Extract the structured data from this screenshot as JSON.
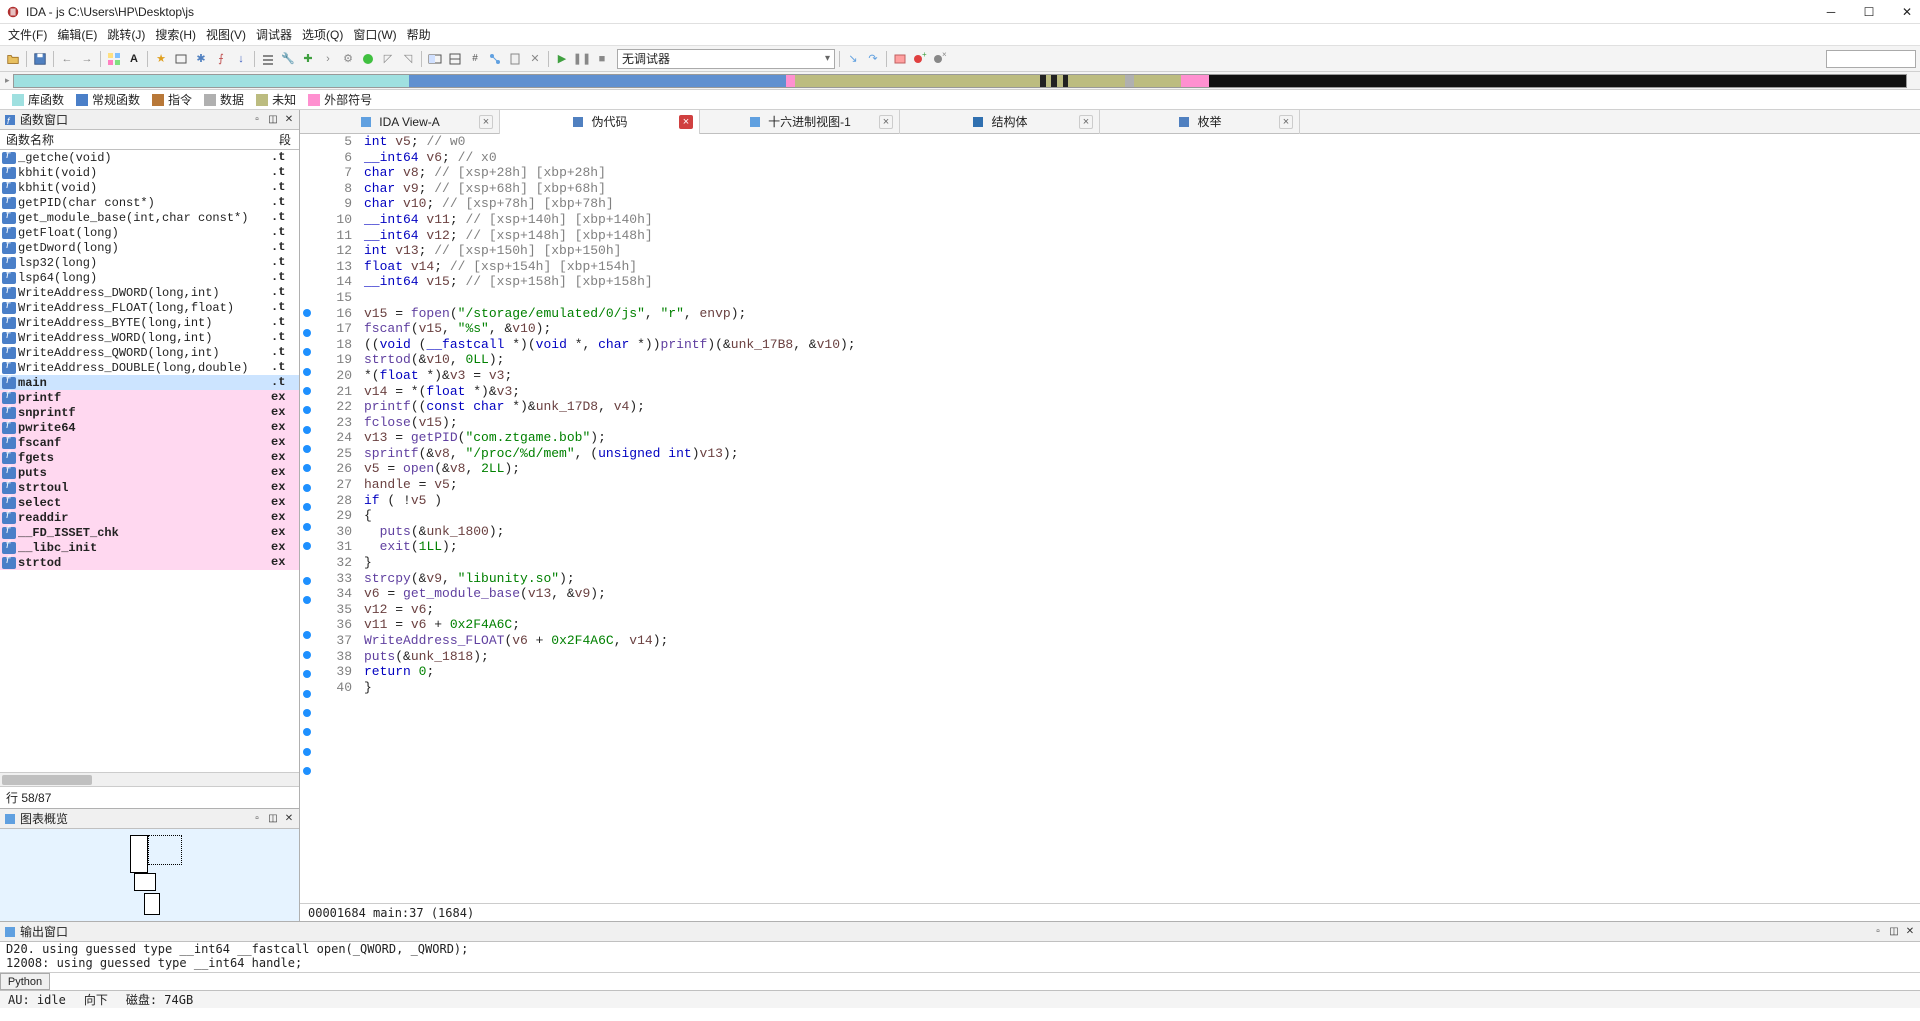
{
  "window": {
    "title": "IDA - js C:\\Users\\HP\\Desktop\\js"
  },
  "menus": [
    "文件(F)",
    "编辑(E)",
    "跳转(J)",
    "搜索(H)",
    "视图(V)",
    "调试器",
    "选项(Q)",
    "窗口(W)",
    "帮助"
  ],
  "debugger_combo": "无调试器",
  "legend": [
    {
      "color": "#9fe0e0",
      "label": "库函数"
    },
    {
      "color": "#4a7fc8",
      "label": "常规函数"
    },
    {
      "color": "#b87838",
      "label": "指令"
    },
    {
      "color": "#b0b0b0",
      "label": "数据"
    },
    {
      "color": "#bcbc80",
      "label": "未知"
    },
    {
      "color": "#ff90d0",
      "label": "外部符号"
    }
  ],
  "functions_panel": {
    "title": "函数窗口",
    "col1": "函数名称",
    "col2": "段",
    "row_count": "行 58/87",
    "items": [
      {
        "name": "_getche(void)",
        "seg": ".t"
      },
      {
        "name": "kbhit(void)",
        "seg": ".t"
      },
      {
        "name": "kbhit(void)",
        "seg": ".t"
      },
      {
        "name": "getPID(char const*)",
        "seg": ".t"
      },
      {
        "name": "get_module_base(int,char const*)",
        "seg": ".t"
      },
      {
        "name": "getFloat(long)",
        "seg": ".t"
      },
      {
        "name": "getDword(long)",
        "seg": ".t"
      },
      {
        "name": "lsp32(long)",
        "seg": ".t"
      },
      {
        "name": "lsp64(long)",
        "seg": ".t"
      },
      {
        "name": "WriteAddress_DWORD(long,int)",
        "seg": ".t"
      },
      {
        "name": "WriteAddress_FLOAT(long,float)",
        "seg": ".t"
      },
      {
        "name": "WriteAddress_BYTE(long,int)",
        "seg": ".t"
      },
      {
        "name": "WriteAddress_WORD(long,int)",
        "seg": ".t"
      },
      {
        "name": "WriteAddress_QWORD(long,int)",
        "seg": ".t"
      },
      {
        "name": "WriteAddress_DOUBLE(long,double)",
        "seg": ".t"
      },
      {
        "name": "main",
        "seg": ".t",
        "bold": true,
        "sel": true
      },
      {
        "name": "printf",
        "seg": "ex",
        "ext": true
      },
      {
        "name": "snprintf",
        "seg": "ex",
        "ext": true
      },
      {
        "name": "pwrite64",
        "seg": "ex",
        "ext": true
      },
      {
        "name": "fscanf",
        "seg": "ex",
        "ext": true
      },
      {
        "name": "fgets",
        "seg": "ex",
        "ext": true
      },
      {
        "name": "puts",
        "seg": "ex",
        "ext": true
      },
      {
        "name": "strtoul",
        "seg": "ex",
        "ext": true
      },
      {
        "name": "select",
        "seg": "ex",
        "ext": true
      },
      {
        "name": "readdir",
        "seg": "ex",
        "ext": true
      },
      {
        "name": "__FD_ISSET_chk",
        "seg": "ex",
        "ext": true
      },
      {
        "name": "__libc_init",
        "seg": "ex",
        "ext": true
      },
      {
        "name": "strtod",
        "seg": "ex",
        "ext": true,
        "cut": true
      }
    ]
  },
  "graph_panel": {
    "title": "图表概览"
  },
  "tabs": [
    {
      "label": "IDA View-A",
      "icon": "view",
      "close": true
    },
    {
      "label": "伪代码",
      "icon": "pseudo",
      "close": true,
      "active": true,
      "closeRed": true
    },
    {
      "label": "十六进制视图-1",
      "icon": "hex",
      "close": true
    },
    {
      "label": "结构体",
      "icon": "struct",
      "close": true
    },
    {
      "label": "枚举",
      "icon": "enum",
      "close": true
    }
  ],
  "code": {
    "first_line": 5,
    "breakpoints": [
      16,
      17,
      18,
      19,
      20,
      21,
      22,
      23,
      24,
      25,
      26,
      27,
      28,
      30,
      31,
      33,
      34,
      35,
      36,
      37,
      38,
      39,
      40
    ],
    "lines": [
      {
        "n": 5,
        "html": "<span class='ty'>int</span> <span class='var'>v5</span>; <span class='cmt'>// w0</span>"
      },
      {
        "n": 6,
        "html": "<span class='ty'>__int64</span> <span class='var'>v6</span>; <span class='cmt'>// x0</span>"
      },
      {
        "n": 7,
        "html": "<span class='ty'>char</span> <span class='var'>v8</span>; <span class='cmt'>// [xsp+28h] [xbp+28h]</span>"
      },
      {
        "n": 8,
        "html": "<span class='ty'>char</span> <span class='var'>v9</span>; <span class='cmt'>// [xsp+68h] [xbp+68h]</span>"
      },
      {
        "n": 9,
        "html": "<span class='ty'>char</span> <span class='var'>v10</span>; <span class='cmt'>// [xsp+78h] [xbp+78h]</span>"
      },
      {
        "n": 10,
        "html": "<span class='ty'>__int64</span> <span class='var'>v11</span>; <span class='cmt'>// [xsp+140h] [xbp+140h]</span>"
      },
      {
        "n": 11,
        "html": "<span class='ty'>__int64</span> <span class='var'>v12</span>; <span class='cmt'>// [xsp+148h] [xbp+148h]</span>"
      },
      {
        "n": 12,
        "html": "<span class='ty'>int</span> <span class='var'>v13</span>; <span class='cmt'>// [xsp+150h] [xbp+150h]</span>"
      },
      {
        "n": 13,
        "html": "<span class='ty'>float</span> <span class='var'>v14</span>; <span class='cmt'>// [xsp+154h] [xbp+154h]</span>"
      },
      {
        "n": 14,
        "html": "<span class='ty'>__int64</span> <span class='var'>v15</span>; <span class='cmt'>// [xsp+158h] [xbp+158h]</span>"
      },
      {
        "n": 15,
        "html": ""
      },
      {
        "n": 16,
        "html": "<span class='var'>v15</span> = <span class='fncall'>fopen</span>(<span class='str'>\"/storage/emulated/0/js\"</span>, <span class='str'>\"r\"</span>, <span class='var'>envp</span>);"
      },
      {
        "n": 17,
        "html": "<span class='fncall'>fscanf</span>(<span class='var'>v15</span>, <span class='str'>\"%s\"</span>, &<span class='var'>v10</span>);"
      },
      {
        "n": 18,
        "html": "((<span class='ty'>void</span> (<span class='ty'>__fastcall</span> *)(<span class='ty'>void</span> *, <span class='ty'>char</span> *))<span class='fncall'>printf</span>)(&<span class='var'>unk_17B8</span>, &<span class='var'>v10</span>);"
      },
      {
        "n": 19,
        "html": "<span class='fncall'>strtod</span>(&<span class='var'>v10</span>, <span class='num'>0LL</span>);"
      },
      {
        "n": 20,
        "html": "*(<span class='ty'>float</span> *)&<span class='var'>v3</span> = <span class='var'>v3</span>;"
      },
      {
        "n": 21,
        "html": "<span class='var'>v14</span> = *(<span class='ty'>float</span> *)&<span class='var'>v3</span>;"
      },
      {
        "n": 22,
        "html": "<span class='fncall'>printf</span>((<span class='ty'>const</span> <span class='ty'>char</span> *)&<span class='var'>unk_17D8</span>, <span class='var'>v4</span>);"
      },
      {
        "n": 23,
        "html": "<span class='fncall'>fclose</span>(<span class='var'>v15</span>);"
      },
      {
        "n": 24,
        "html": "<span class='var'>v13</span> = <span class='fncall'>getPID</span>(<span class='str'>\"com.ztgame.bob\"</span>);"
      },
      {
        "n": 25,
        "html": "<span class='fncall'>sprintf</span>(&<span class='var'>v8</span>, <span class='str'>\"/proc/%d/mem\"</span>, (<span class='ty'>unsigned</span> <span class='ty'>int</span>)<span class='var'>v13</span>);"
      },
      {
        "n": 26,
        "html": "<span class='var'>v5</span> = <span class='fncall'>open</span>(&<span class='var'>v8</span>, <span class='num'>2LL</span>);"
      },
      {
        "n": 27,
        "html": "<span class='var'>handle</span> = <span class='var'>v5</span>;"
      },
      {
        "n": 28,
        "html": "<span class='kw'>if</span> ( !<span class='var'>v5</span> )"
      },
      {
        "n": 29,
        "html": "{"
      },
      {
        "n": 30,
        "html": "  <span class='fncall'>puts</span>(&<span class='var'>unk_1800</span>);"
      },
      {
        "n": 31,
        "html": "  <span class='fncall'>exit</span>(<span class='num'>1LL</span>);"
      },
      {
        "n": 32,
        "html": "}"
      },
      {
        "n": 33,
        "html": "<span class='fncall'>strcpy</span>(&<span class='var'>v9</span>, <span class='str'>\"libunity.so\"</span>);"
      },
      {
        "n": 34,
        "html": "<span class='var'>v6</span> = <span class='fncall'>get_module_base</span>(<span class='var'>v13</span>, &<span class='var'>v9</span>);"
      },
      {
        "n": 35,
        "html": "<span class='var'>v12</span> = <span class='var'>v6</span>;"
      },
      {
        "n": 36,
        "html": "<span class='var'>v11</span> = <span class='var'>v6</span> + <span class='num'>0x2F4A6C</span>;"
      },
      {
        "n": 37,
        "html": "<span class='fncall'>WriteAddress_FLOAT</span>(<span class='var'>v6</span> + <span class='num'>0x2F4A6C</span>, <span class='var'>v14</span>);"
      },
      {
        "n": 38,
        "html": "<span class='fncall'>puts</span>(&<span class='var'>unk_1818</span>);"
      },
      {
        "n": 39,
        "html": "<span class='kw'>return</span> <span class='num'>0</span>;"
      },
      {
        "n": 40,
        "html": "}"
      }
    ],
    "status": "00001684 main:37 (1684)"
  },
  "output_panel": {
    "title": "输出窗口",
    "lines": [
      "D20. using guessed type __int64 __fastcall open(_QWORD, _QWORD);",
      "12008: using guessed type __int64 handle;"
    ],
    "python_btn": "Python"
  },
  "statusbar": {
    "au": "AU:",
    "idle": "idle",
    "down": "向下",
    "disk": "磁盘: 74GB"
  }
}
